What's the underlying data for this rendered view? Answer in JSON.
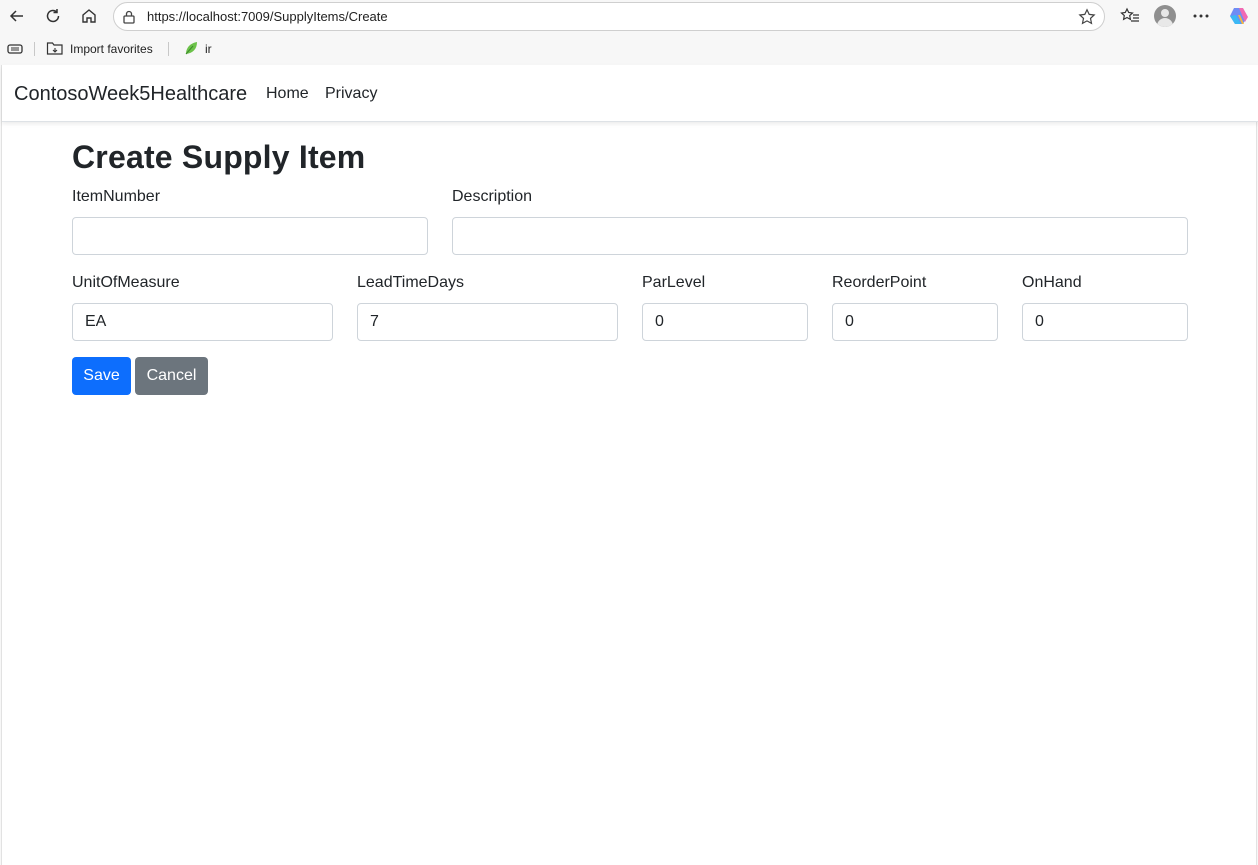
{
  "browser": {
    "url": "https://localhost:7009/SupplyItems/Create",
    "favorites": [
      {
        "label": "Import favorites"
      },
      {
        "label": "ir"
      }
    ]
  },
  "navbar": {
    "brand": "ContosoWeek5Healthcare",
    "links": [
      {
        "label": "Home"
      },
      {
        "label": "Privacy"
      }
    ]
  },
  "form": {
    "title": "Create Supply Item",
    "fields": {
      "item_number": {
        "label": "ItemNumber",
        "value": ""
      },
      "description": {
        "label": "Description",
        "value": ""
      },
      "unit_of_measure": {
        "label": "UnitOfMeasure",
        "value": "EA"
      },
      "lead_time_days": {
        "label": "LeadTimeDays",
        "value": "7"
      },
      "par_level": {
        "label": "ParLevel",
        "value": "0"
      },
      "reorder_point": {
        "label": "ReorderPoint",
        "value": "0"
      },
      "on_hand": {
        "label": "OnHand",
        "value": "0"
      }
    },
    "save_label": "Save",
    "cancel_label": "Cancel"
  },
  "colors": {
    "primary": "#0d6efd",
    "secondary": "#6c757d"
  }
}
